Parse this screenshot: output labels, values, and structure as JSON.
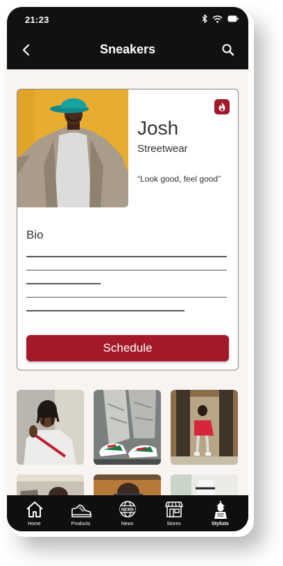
{
  "status_bar": {
    "time": "21:23",
    "icons": [
      "bluetooth-icon",
      "wifi-icon",
      "battery-icon"
    ]
  },
  "header": {
    "title": "Sneakers",
    "back_icon": "chevron-left-icon",
    "search_icon": "search-icon"
  },
  "profile": {
    "name": "Josh",
    "style": "Streetwear",
    "quote": "“Look good, feel good”",
    "badge_icon": "fire-icon",
    "bio_heading": "Bio",
    "bio_lines_fill": [
      1.0,
      1.0,
      0.37,
      1.0,
      0.79
    ],
    "schedule_label": "Schedule"
  },
  "gallery": {
    "tiles": [
      "outfit-photo",
      "sneakers-photo",
      "street-style-photo",
      "outfit-photo",
      "outfit-photo",
      "outfit-photo"
    ]
  },
  "tab_bar": {
    "tabs": [
      {
        "label": "Home",
        "icon": "home-icon",
        "active": false
      },
      {
        "label": "Products",
        "icon": "sneaker-icon",
        "active": false
      },
      {
        "label": "News",
        "icon": "news-globe-icon",
        "active": false
      },
      {
        "label": "Stores",
        "icon": "store-icon",
        "active": false
      },
      {
        "label": "Stylists",
        "icon": "stylist-icon",
        "active": true
      }
    ]
  },
  "colors": {
    "accent": "#a3192a",
    "photo_background": "#e9ad2d",
    "content_background": "#f8f4f2",
    "chrome": "#111111"
  }
}
